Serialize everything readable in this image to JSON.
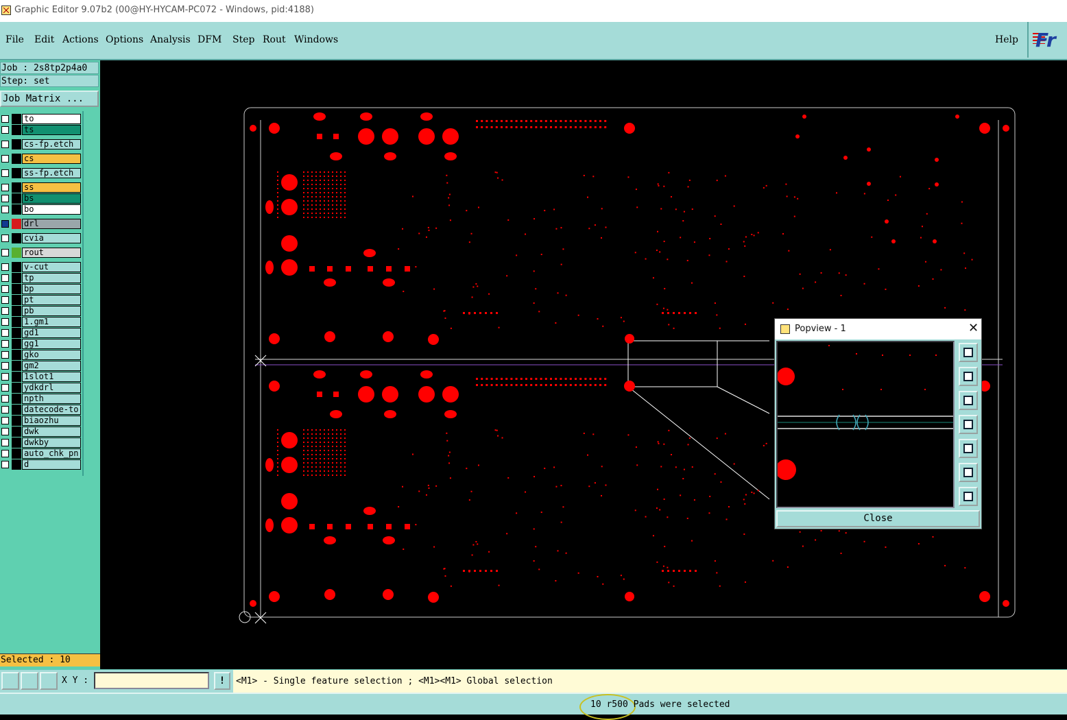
{
  "window": {
    "title": "Graphic Editor 9.07b2 (00@HY-HYCAM-PC072 - Windows, pid:4188)"
  },
  "menu": {
    "items": [
      {
        "label": "File"
      },
      {
        "label": "Edit"
      },
      {
        "label": "Actions"
      },
      {
        "label": "Options"
      },
      {
        "label": "Analysis"
      },
      {
        "label": "DFM"
      },
      {
        "label": "Step"
      },
      {
        "label": "Rout"
      },
      {
        "label": "Windows"
      }
    ],
    "help": "Help",
    "logo": "Fr"
  },
  "job": {
    "job_line": "Job : 2s8tp2p4a0",
    "step_line": "Step: set",
    "matrix_button": "Job Matrix ..."
  },
  "layers": [
    {
      "name": "to",
      "color": "#ffffff"
    },
    {
      "name": "ts",
      "color": "#119070"
    },
    {
      "name": "cs-fp.etch",
      "color": "#a5dcd8"
    },
    {
      "name": "cs",
      "color": "#f5c043"
    },
    {
      "name": "ss-fp.etch",
      "color": "#a5dcd8"
    },
    {
      "name": "ss",
      "color": "#f5c043"
    },
    {
      "name": "bs",
      "color": "#119070"
    },
    {
      "name": "bo",
      "color": "#ffffff"
    },
    {
      "name": "drl",
      "color": "#9aa6aa"
    },
    {
      "name": "cvia",
      "color": "#a5dcd8"
    },
    {
      "name": "rout",
      "color": "#d8d8d8"
    },
    {
      "name": "v-cut",
      "color": "#a5dcd8"
    },
    {
      "name": "tp",
      "color": "#a5dcd8"
    },
    {
      "name": "bp",
      "color": "#a5dcd8"
    },
    {
      "name": "pt",
      "color": "#a5dcd8"
    },
    {
      "name": "pb",
      "color": "#a5dcd8"
    },
    {
      "name": "1.gm1",
      "color": "#a5dcd8"
    },
    {
      "name": "gd1",
      "color": "#a5dcd8"
    },
    {
      "name": "gg1",
      "color": "#a5dcd8"
    },
    {
      "name": "gko",
      "color": "#a5dcd8"
    },
    {
      "name": "gm2",
      "color": "#a5dcd8"
    },
    {
      "name": "1slot1",
      "color": "#a5dcd8"
    },
    {
      "name": "ydkdrl",
      "color": "#a5dcd8"
    },
    {
      "name": "npth",
      "color": "#a5dcd8"
    },
    {
      "name": "datecode-to",
      "color": "#a5dcd8"
    },
    {
      "name": "biaozhu",
      "color": "#a5dcd8"
    },
    {
      "name": "dwk",
      "color": "#a5dcd8"
    },
    {
      "name": "dwkby",
      "color": "#a5dcd8"
    },
    {
      "name": "auto_chk_pn",
      "color": "#a5dcd8"
    },
    {
      "name": "d",
      "color": "#a5dcd8"
    }
  ],
  "selected_count": "Selected : 10",
  "bottom": {
    "xy_label": "X Y :",
    "xy_value": "",
    "warning_glyph": "!",
    "prompt": "<M1> - Single feature selection ; <M1><M1> Global selection"
  },
  "status": "10 r500 Pads were selected",
  "popview": {
    "title": "Popview - 1",
    "close": "Close",
    "close_x": "✕"
  },
  "colors": {
    "pad": "#ff0000",
    "panel": "#a5dcd8",
    "layer_panel": "#5fd0b0"
  }
}
